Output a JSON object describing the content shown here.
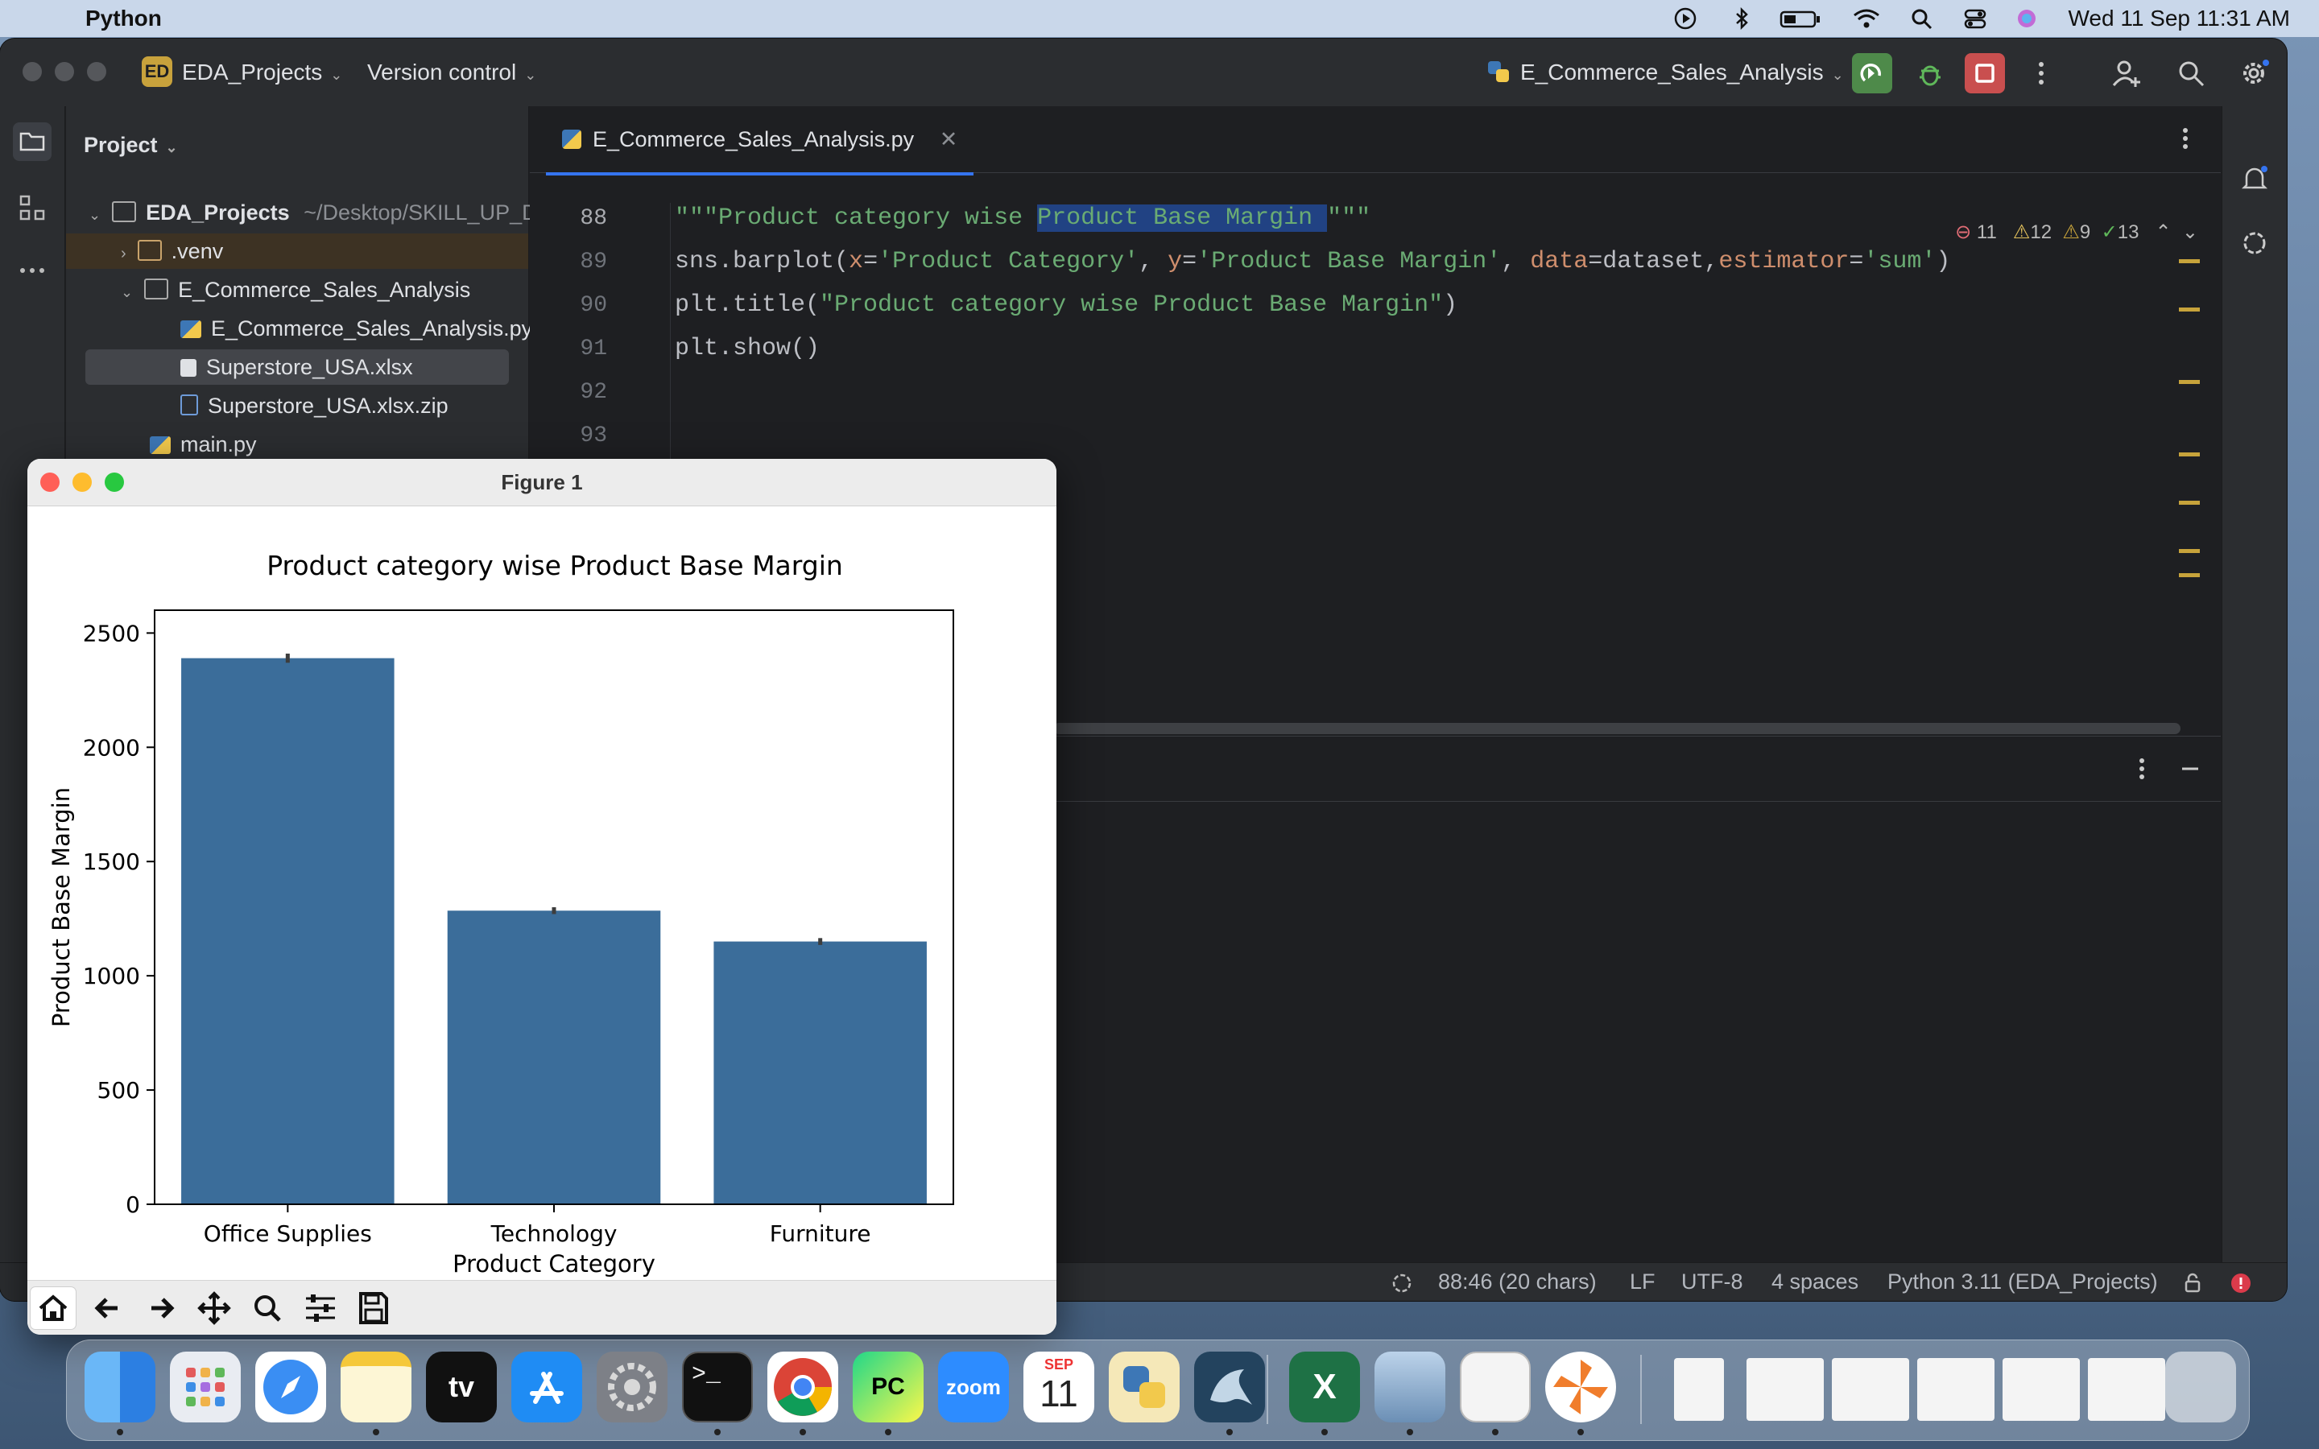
{
  "menubar": {
    "app_name": "Python",
    "clock": "Wed 11 Sep  11:31 AM"
  },
  "ide": {
    "project_name": "EDA_Projects",
    "project_badge": "ED",
    "version_control": "Version control",
    "run_config": "E_Commerce_Sales_Analysis"
  },
  "project_panel": {
    "title": "Project",
    "items": [
      {
        "label": "EDA_Projects",
        "suffix": "~/Desktop/SKILL_UP_D..."
      },
      {
        "label": ".venv"
      },
      {
        "label": "E_Commerce_Sales_Analysis"
      },
      {
        "label": "E_Commerce_Sales_Analysis.py"
      },
      {
        "label": "Superstore_USA.xlsx"
      },
      {
        "label": "Superstore_USA.xlsx.zip"
      },
      {
        "label": "main.py"
      }
    ]
  },
  "editor": {
    "tab": "E_Commerce_Sales_Analysis.py",
    "line_numbers": [
      "88",
      "89",
      "90",
      "91",
      "92",
      "93"
    ],
    "inspections": {
      "errors": "11",
      "warnings_a": "12",
      "warnings_b": "9",
      "ok": "13"
    }
  },
  "statusbar": {
    "position": "88:46 (20 chars)",
    "line_sep": "LF",
    "encoding": "UTF-8",
    "indent": "4 spaces",
    "interpreter": "Python 3.11 (EDA_Projects)"
  },
  "figure": {
    "window_title": "Figure 1"
  },
  "chart_data": {
    "type": "bar",
    "title": "Product category wise Product Base Margin",
    "xlabel": "Product Category",
    "ylabel": "Product Base Margin",
    "categories": [
      "Office Supplies",
      "Technology",
      "Furniture"
    ],
    "values": [
      2390,
      1285,
      1150
    ],
    "error": [
      20,
      15,
      15
    ],
    "ylim": [
      0,
      2600
    ],
    "yticks": [
      0,
      500,
      1000,
      1500,
      2000,
      2500
    ],
    "bar_color": "#3b6d9a",
    "grid": false
  },
  "dock": {
    "calendar_month": "SEP",
    "calendar_day": "11",
    "zoom_label": "zoom"
  },
  "colors": {
    "ide_bg": "#1e1f22",
    "panel_bg": "#2b2d30",
    "accent": "#3574f0",
    "string_green": "#6aab73",
    "keyword_orange": "#cf8e6d"
  }
}
